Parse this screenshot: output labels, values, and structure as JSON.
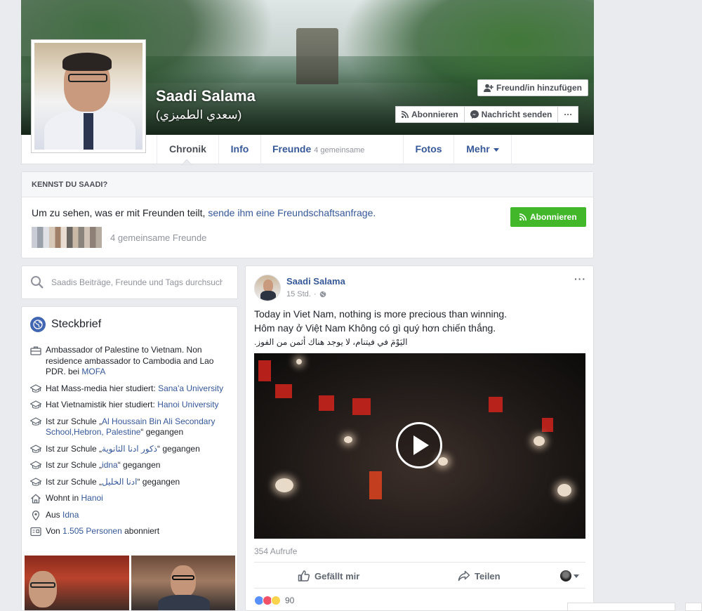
{
  "profile": {
    "name": "Saadi Salama",
    "alt_name": "(سعدي الطميزي)"
  },
  "cover_buttons": {
    "add_friend": "Freund/in hinzufügen",
    "follow": "Abonnieren",
    "message": "Nachricht senden",
    "more": "···"
  },
  "tabs": [
    {
      "label": "Chronik"
    },
    {
      "label": "Info"
    },
    {
      "label": "Freunde",
      "sub": "4 gemeinsame Freunde"
    },
    {
      "label": "Fotos"
    },
    {
      "label": "Mehr"
    }
  ],
  "know_box": {
    "heading": "KENNST DU SAADI?",
    "text_before": "Um zu sehen, was er mit Freunden teilt,",
    "text_link": "sende ihm eine Freundschaftsanfrage.",
    "mutual": "4 gemeinsame Freunde",
    "follow_button": "Abonnieren"
  },
  "search": {
    "placeholder": "Saadis Beiträge, Freunde und Tags durchsuchen"
  },
  "about": {
    "title": "Steckbrief",
    "items": [
      {
        "icon": "briefcase-icon",
        "text": "Ambassador of Palestine to Vietnam. Non residence ambassador to Cambodia and Lao PDR. bei ",
        "link": "MOFA",
        "after": ""
      },
      {
        "icon": "graduation-cap-icon",
        "text": "Hat Mass-media hier studiert: ",
        "link": "Sana'a University",
        "after": ""
      },
      {
        "icon": "graduation-cap-icon",
        "text": "Hat Vietnamistik hier studiert: ",
        "link": "Hanoi University",
        "after": ""
      },
      {
        "icon": "graduation-cap-icon",
        "text": "Ist zur Schule „",
        "link": "Al Houssain Bin Ali Secondary School,Hebron, Palestine",
        "after": "“ gegangen"
      },
      {
        "icon": "graduation-cap-icon",
        "text": "Ist zur Schule „",
        "link": "ذكور ادنا الثانوية",
        "after": "“ gegangen"
      },
      {
        "icon": "graduation-cap-icon",
        "text": "Ist zur Schule „",
        "link": "idna",
        "after": "“ gegangen"
      },
      {
        "icon": "graduation-cap-icon",
        "text": "Ist zur Schule „",
        "link": "ادنا الخليل",
        "after": "“ gegangen"
      },
      {
        "icon": "home-icon",
        "text": "Wohnt in ",
        "link": "Hanoi",
        "after": ""
      },
      {
        "icon": "location-pin-icon",
        "text": "Aus ",
        "link": "Idna",
        "after": ""
      },
      {
        "icon": "followers-icon",
        "text": "Von ",
        "link": "1.505 Personen",
        "after": " abonniert"
      }
    ]
  },
  "post": {
    "author": "Saadi Salama",
    "time": "15 Std.",
    "more": "···",
    "lines": [
      "Today in Viet Nam, nothing is more precious than winning.",
      "Hôm nay ở Việt Nam Không có gì quý hơn chiến thắng."
    ],
    "arabic_line": "اليَوْمَ في فيتنام، لا يوجد هناك أثمن من الفوز.",
    "views": "354 Aufrufe",
    "like": "Gefällt mir",
    "share": "Teilen",
    "reaction_count": "90"
  },
  "colors": {
    "link": "#365899",
    "green": "#42b72a",
    "fb_blue": "#4267b2"
  }
}
